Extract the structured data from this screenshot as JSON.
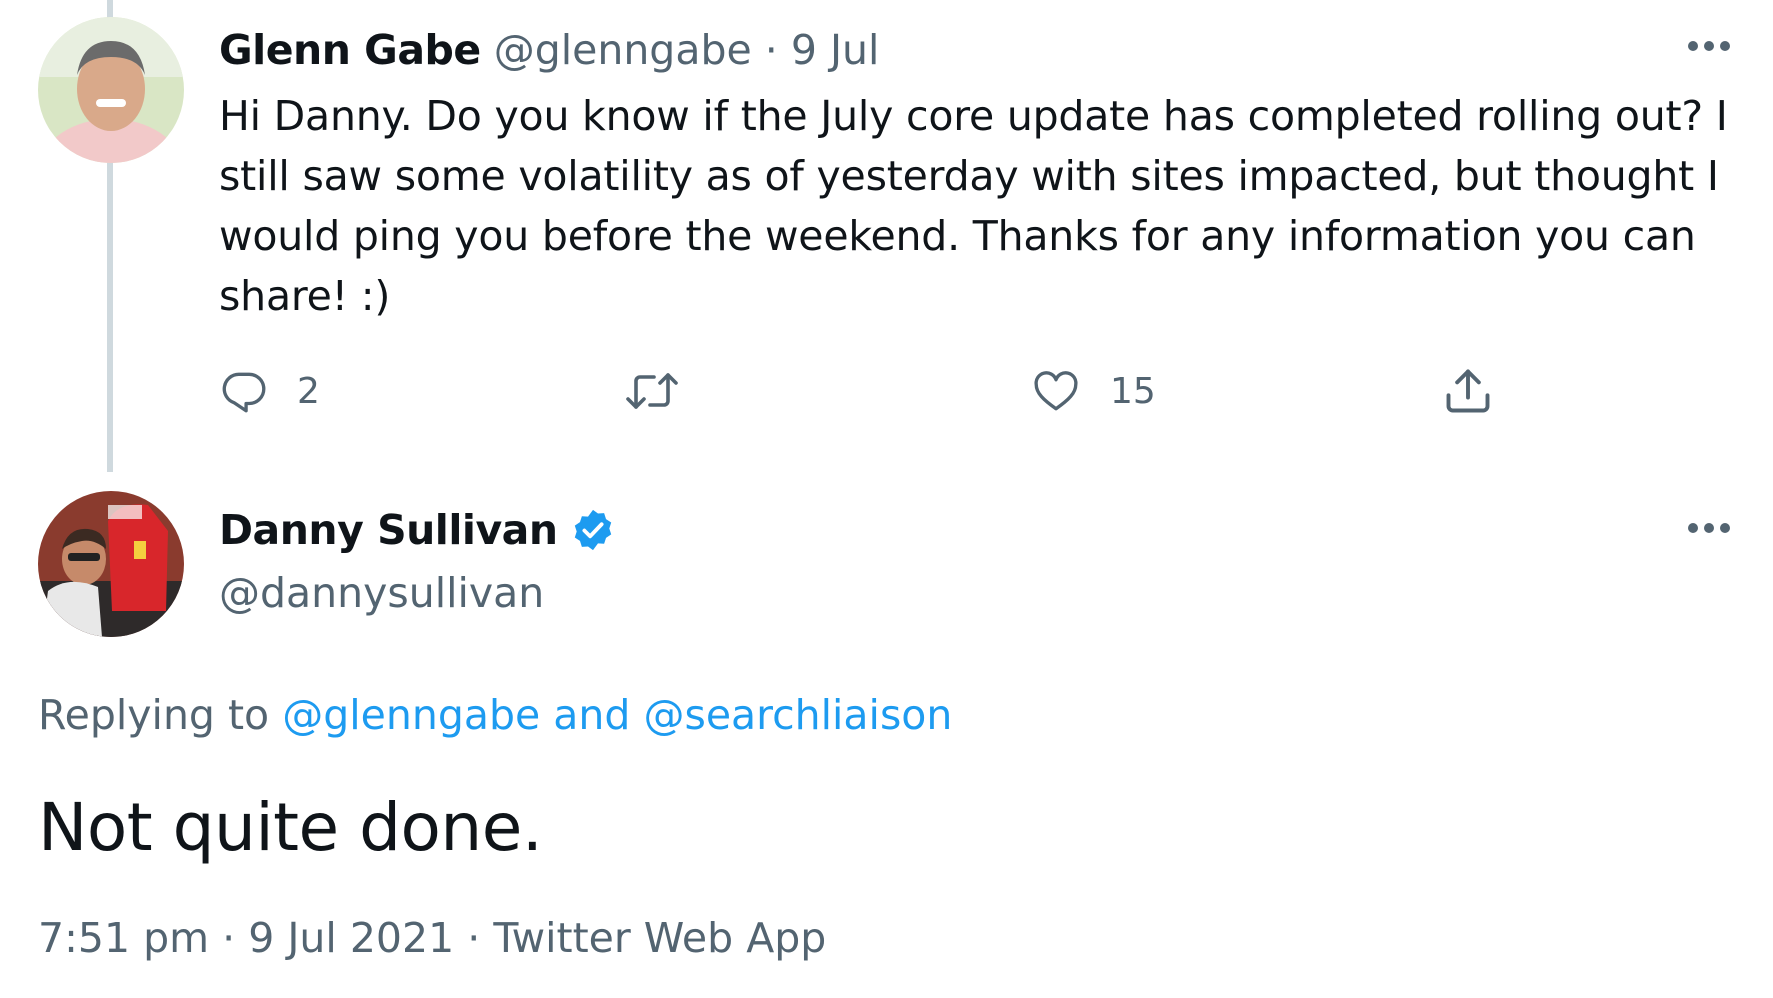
{
  "tweet1": {
    "author_name": "Glenn Gabe",
    "handle": "@glenngabe",
    "separator": "·",
    "date": "9 Jul",
    "text": "Hi Danny. Do you know if the July core update has completed rolling out? I still saw some volatility as of yesterday with sites impacted, but thought I would ping you before the weekend. Thanks for any information you can share! :)",
    "actions": {
      "reply_count": "2",
      "retweet_count": "",
      "like_count": "15"
    }
  },
  "tweet2": {
    "author_name": "Danny Sullivan",
    "handle": "@dannysullivan",
    "replying_prefix": "Replying to",
    "reply_to_1": "@glenngabe",
    "reply_and": "and",
    "reply_to_2": "@searchliaison",
    "text": "Not quite done.",
    "time": "7:51 pm",
    "separator": "·",
    "date": "9 Jul 2021",
    "source_separator": "·",
    "source": "Twitter Web App"
  },
  "colors": {
    "link": "#1d9bf0",
    "muted": "#536471",
    "text": "#0f1419",
    "thread_line": "#cfd9de"
  },
  "icons": {
    "more": "more-horizontal-icon",
    "reply": "reply-icon",
    "retweet": "retweet-icon",
    "like": "heart-icon",
    "share": "share-icon",
    "verified": "verified-badge-icon"
  }
}
